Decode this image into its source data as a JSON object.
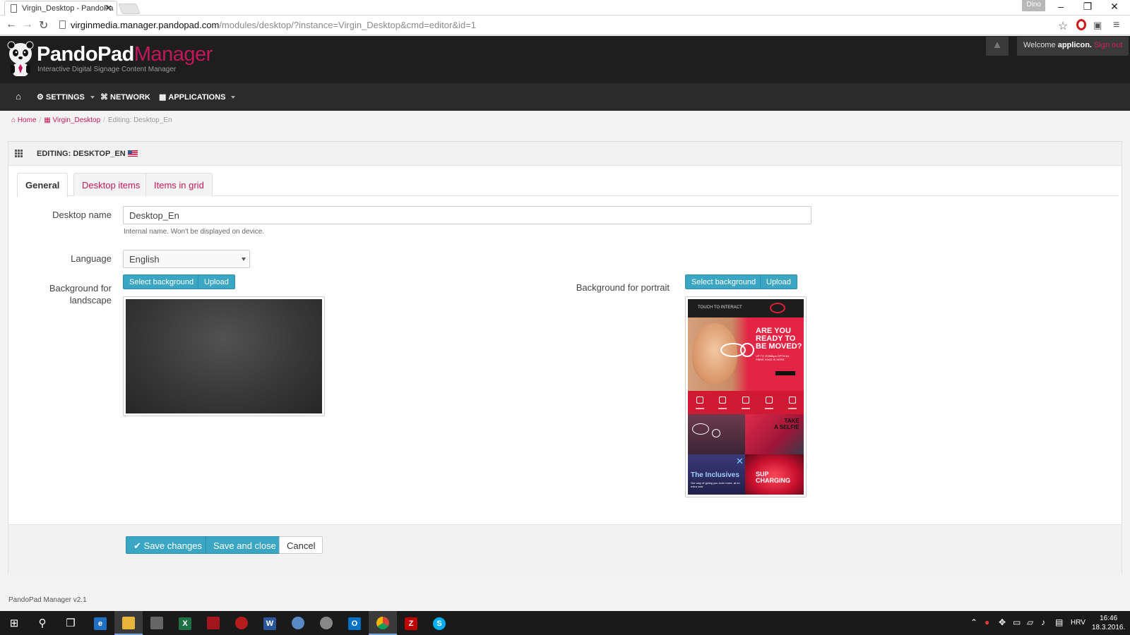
{
  "browser": {
    "tab_title": "Virgin_Desktop - PandoPa",
    "user_badge": "Dino",
    "url_host": "virginmedia.manager.pandopad.com",
    "url_path": "/modules/desktop/?instance=Virgin_Desktop&cmd=editor&id=1",
    "icons": [
      "back-icon",
      "forward-icon",
      "reload-icon",
      "star-icon",
      "opera-icon",
      "extension-icon",
      "menu-icon"
    ]
  },
  "header": {
    "brand_main": "PandoPad",
    "brand_accent": "Manager",
    "tagline": "Interactive Digital Signage Content Manager",
    "welcome_prefix": "Welcome ",
    "username": "applicon.",
    "sign_out": "Sign out"
  },
  "nav": {
    "settings": "SETTINGS",
    "network": "NETWORK",
    "applications": "APPLICATIONS"
  },
  "breadcrumb": {
    "home": "Home",
    "instance": "Virgin_Desktop",
    "current": "Editing: Desktop_En"
  },
  "panel": {
    "title": "EDITING: DESKTOP_EN",
    "tabs": [
      {
        "label": "General",
        "active": true
      },
      {
        "label": "Desktop items",
        "active": false
      },
      {
        "label": "Items in grid",
        "active": false
      }
    ],
    "form": {
      "desktop_name_label": "Desktop name",
      "desktop_name_value": "Desktop_En",
      "desktop_name_help": "Internal name. Won't be displayed on device.",
      "language_label": "Language",
      "language_value": "English",
      "bg_landscape_label_1": "Background for",
      "bg_landscape_label_2": "landscape",
      "bg_portrait_label": "Background for portrait",
      "select_background": "Select background",
      "upload": "Upload"
    },
    "portrait_preview": {
      "touch": "TOUCH TO INTERACT",
      "headline_1": "ARE YOU",
      "headline_2": "READY TO",
      "headline_3": "BE MOVED?",
      "sub": "UP TO 200Mbps OPTICAL FIBRE VIVID IS HERE.",
      "selfie_1": "TAKE",
      "selfie_2": "A SELFIE",
      "inclusives": "The Inclusives",
      "inclusives_sub": "Our way of giving you even more, at no extra cost",
      "supercharging_1": "SUP",
      "supercharging_2": "CHARGING"
    },
    "footer_buttons": {
      "save_changes": "Save changes",
      "save_and_close": "Save and close",
      "cancel": "Cancel"
    }
  },
  "app_footer": "PandoPad Manager v2.1",
  "taskbar": {
    "language": "HRV",
    "time": "16:46",
    "date": "18.3.2016."
  },
  "colors": {
    "accent": "#c2185b",
    "button": "#3aa6c4",
    "header_bg": "#1e1e1e",
    "nav_bg": "#2b2b2b"
  }
}
